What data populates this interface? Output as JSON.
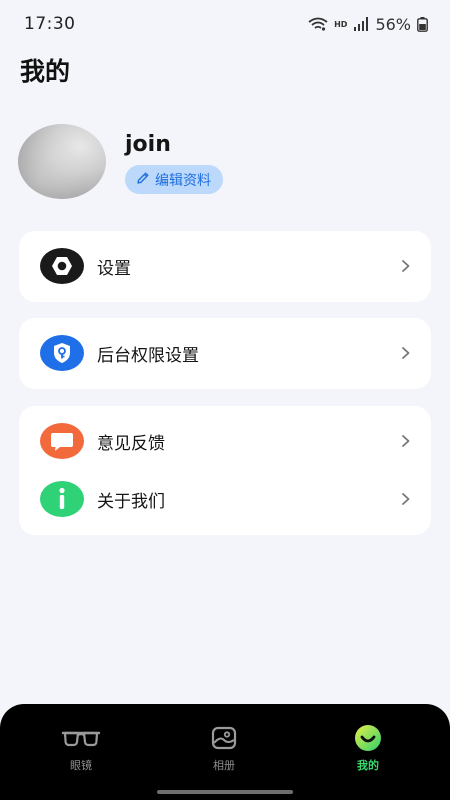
{
  "status_bar": {
    "time": "17:30",
    "network_tag": "HD",
    "battery": "56%",
    "icons": [
      "wifi-icon",
      "signal-icon",
      "battery-icon"
    ]
  },
  "page": {
    "title": "我的"
  },
  "profile": {
    "username": "join",
    "edit_label": "编辑资料",
    "edit_icon": "pencil-icon"
  },
  "menu": {
    "settings": {
      "label": "设置",
      "icon": "settings-icon",
      "color": "#1a1a1a"
    },
    "permissions": {
      "label": "后台权限设置",
      "icon": "shield-key-icon",
      "color": "#1f6fe8"
    },
    "feedback": {
      "label": "意见反馈",
      "icon": "chat-bubble-icon",
      "color": "#f26a3c"
    },
    "about": {
      "label": "关于我们",
      "icon": "info-icon",
      "color": "#2fd277"
    }
  },
  "bottom_nav": {
    "items": [
      {
        "label": "眼镜",
        "icon": "glasses-icon"
      },
      {
        "label": "相册",
        "icon": "album-icon"
      },
      {
        "label": "我的",
        "icon": "profile-smile-icon",
        "active": true
      }
    ],
    "active_color": "#3ad96c"
  }
}
